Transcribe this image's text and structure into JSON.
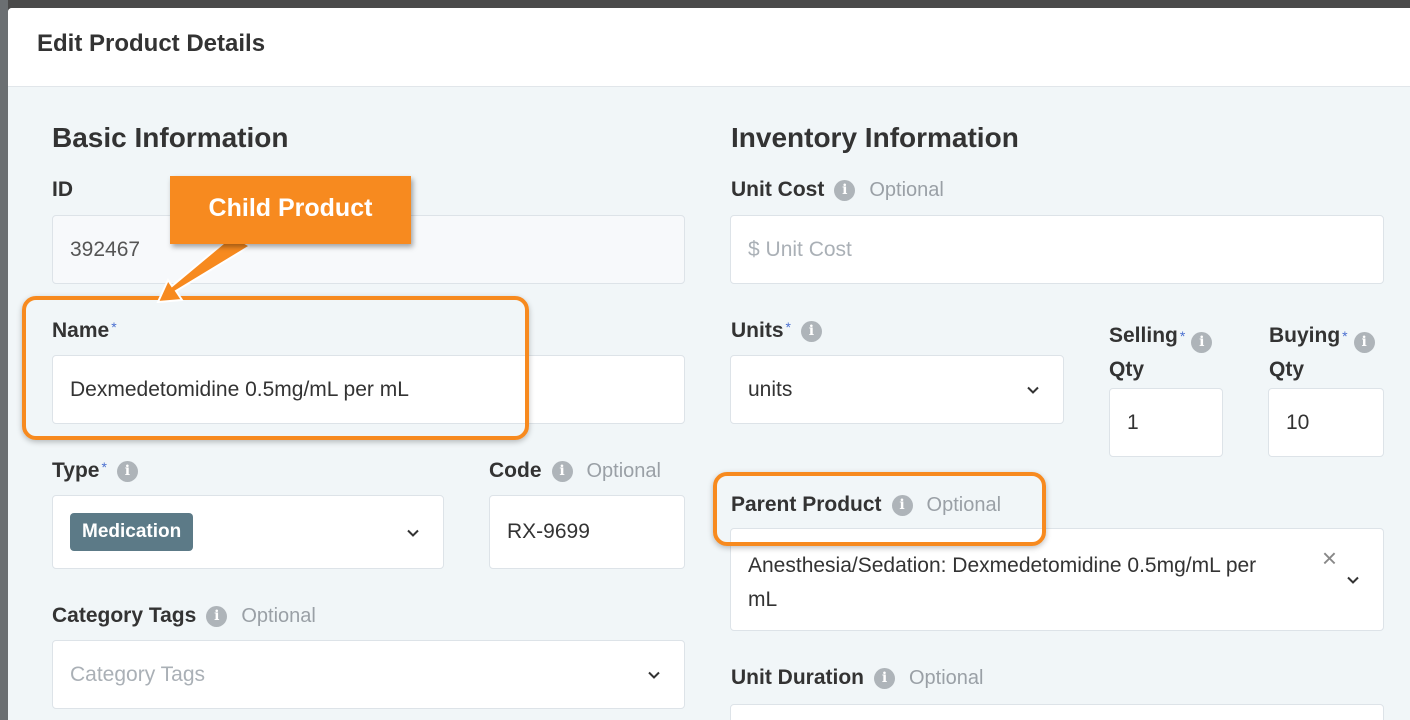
{
  "modal": {
    "title": "Edit Product Details"
  },
  "basic": {
    "title": "Basic Information",
    "id_label": "ID",
    "id_value": "392467",
    "name_label": "Name",
    "name_value": "Dexmedetomidine 0.5mg/mL per mL",
    "type_label": "Type",
    "type_value": "Medication",
    "code_label": "Code",
    "code_optional": "Optional",
    "code_value": "RX-9699",
    "category_label": "Category Tags",
    "category_optional": "Optional",
    "category_placeholder": "Category Tags"
  },
  "inventory": {
    "title": "Inventory Information",
    "unit_cost_label": "Unit Cost",
    "unit_cost_optional": "Optional",
    "unit_cost_prefix": "$",
    "unit_cost_placeholder": "Unit Cost",
    "units_label": "Units",
    "units_value": "units",
    "selling_label_1": "Selling",
    "selling_label_2": "Qty",
    "selling_value": "1",
    "buying_label_1": "Buying",
    "buying_label_2": "Qty",
    "buying_value": "10",
    "parent_label": "Parent Product",
    "parent_optional": "Optional",
    "parent_value_line1": "Anesthesia/Sedation: Dexmedetomidine 0.5mg/mL per",
    "parent_value_line2": "mL",
    "duration_label": "Unit Duration",
    "duration_optional": "Optional"
  },
  "annotations": {
    "callout_text": "Child Product"
  },
  "common": {
    "required_mark": "*",
    "info_glyph": "i",
    "clear_glyph": "×"
  },
  "colors": {
    "accent": "#f78a1f",
    "badge": "#5c7a87",
    "required": "#4a6fd0"
  }
}
